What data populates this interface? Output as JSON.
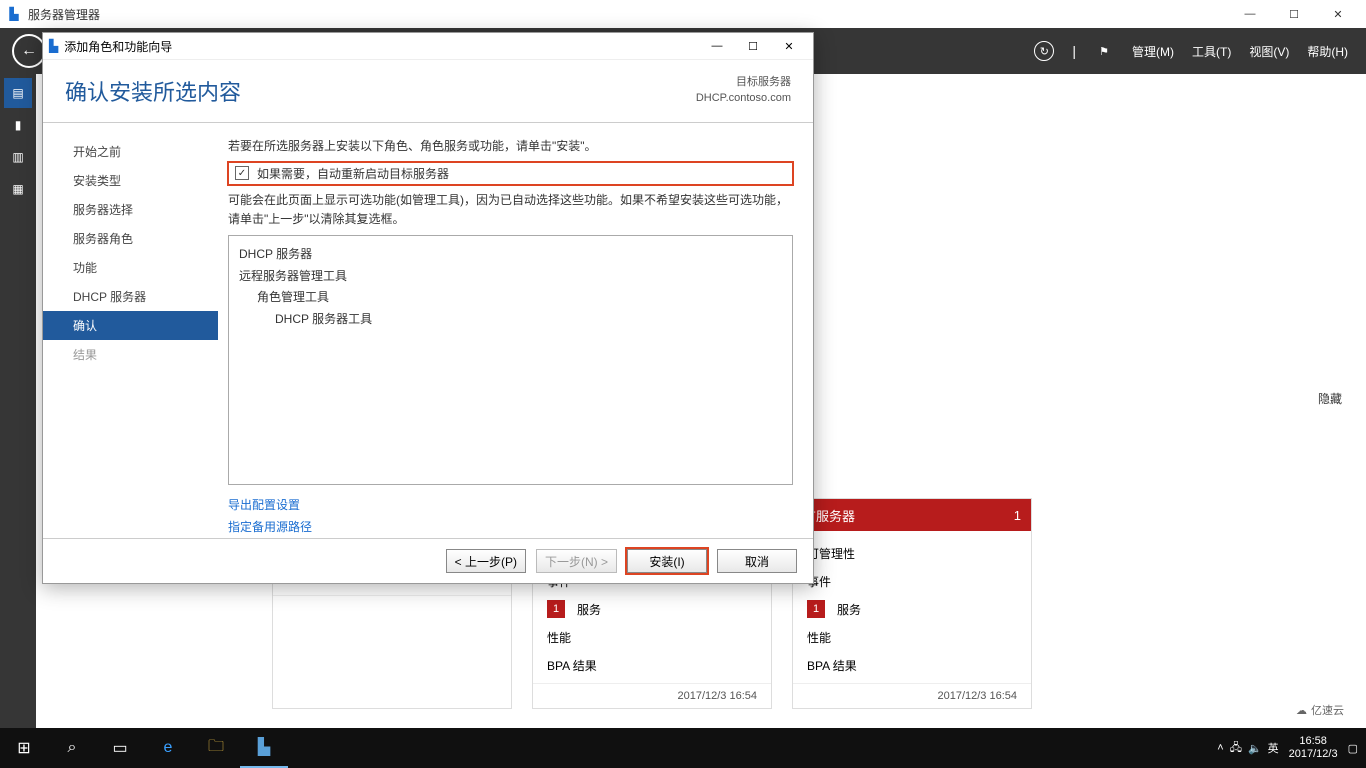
{
  "main": {
    "title": "服务器管理器",
    "win_controls": {
      "min": "—",
      "max": "☐",
      "close": "✕"
    },
    "menu": {
      "manage": "管理(M)",
      "tools": "工具(T)",
      "view": "视图(V)",
      "help": "帮助(H)"
    },
    "hide": "隐藏"
  },
  "tiles": {
    "hdr_label": "有服务器",
    "hdr_count": "1",
    "rows": {
      "manageability": "可管理性",
      "events": "事件",
      "services": "服务",
      "performance": "性能",
      "bpa": "BPA 结果"
    },
    "badge": "1",
    "timestamp": "2017/12/3 16:54"
  },
  "wizard": {
    "title": "添加角色和功能向导",
    "heading": "确认安装所选内容",
    "target_label": "目标服务器",
    "target_server": "DHCP.contoso.com",
    "nav": {
      "before": "开始之前",
      "type": "安装类型",
      "server_sel": "服务器选择",
      "server_role": "服务器角色",
      "features": "功能",
      "dhcp": "DHCP 服务器",
      "confirm": "确认",
      "result": "结果"
    },
    "intro": "若要在所选服务器上安装以下角色、角色服务或功能，请单击\"安装\"。",
    "checkbox_label": "如果需要，自动重新启动目标服务器",
    "optional_note": "可能会在此页面上显示可选功能(如管理工具)，因为已自动选择这些功能。如果不希望安装这些可选功能，请单击\"上一步\"以清除其复选框。",
    "roles": {
      "l1": "DHCP 服务器",
      "l2": "远程服务器管理工具",
      "l3": "角色管理工具",
      "l4": "DHCP 服务器工具"
    },
    "links": {
      "export": "导出配置设置",
      "altpath": "指定备用源路径"
    },
    "buttons": {
      "prev": "< 上一步(P)",
      "next": "下一步(N) >",
      "install": "安装(I)",
      "cancel": "取消"
    }
  },
  "taskbar": {
    "ime": "英",
    "time": "16:58",
    "date": "2017/12/3"
  },
  "watermark": "亿速云"
}
